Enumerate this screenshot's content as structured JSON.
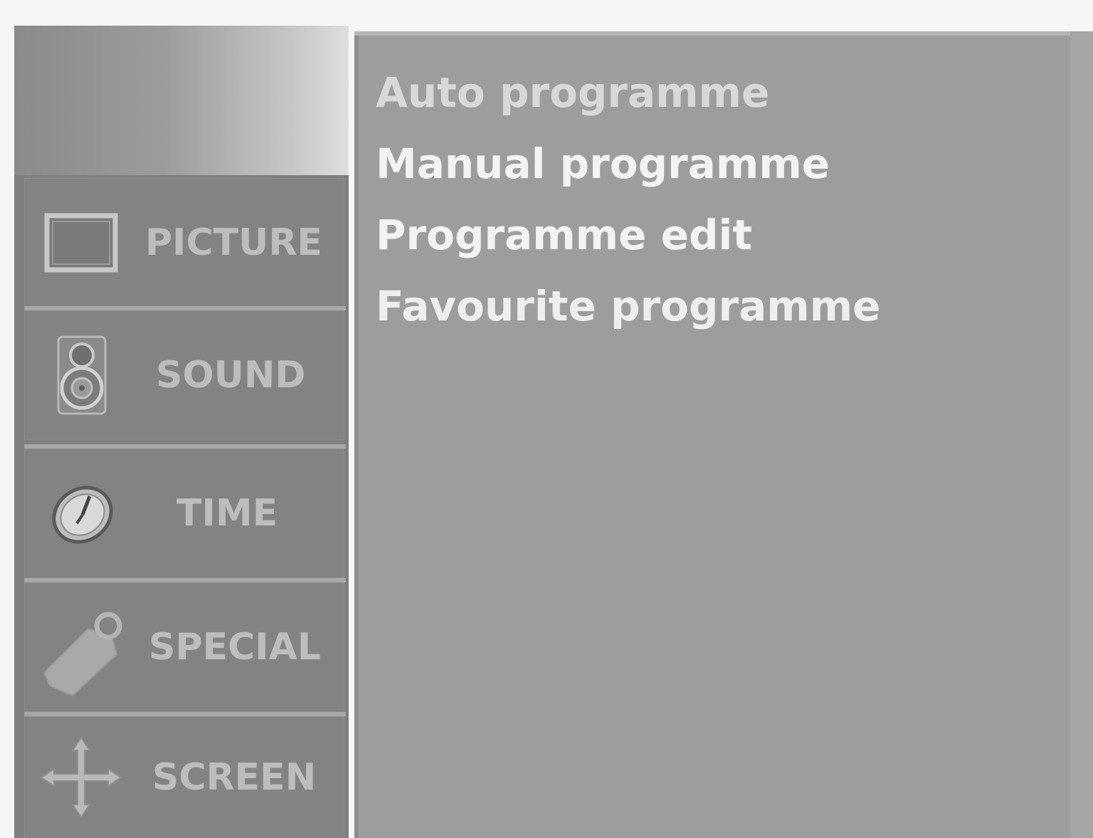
{
  "sidebar": {
    "items": [
      {
        "label": "PICTURE",
        "icon": "picture-icon"
      },
      {
        "label": "SOUND",
        "icon": "speaker-icon"
      },
      {
        "label": "TIME",
        "icon": "clock-icon"
      },
      {
        "label": "SPECIAL",
        "icon": "tag-icon"
      },
      {
        "label": "SCREEN",
        "icon": "move-arrows-icon"
      }
    ]
  },
  "menu": {
    "items": [
      {
        "label": "Auto programme"
      },
      {
        "label": "Manual programme"
      },
      {
        "label": "Programme edit"
      },
      {
        "label": "Favourite programme"
      }
    ]
  },
  "colors": {
    "panel_background": "#9d9d9d",
    "sidebar_background": "#838383",
    "menu_text_dim": "#d6d6d6",
    "menu_text_bright": "#f2f2f2"
  }
}
